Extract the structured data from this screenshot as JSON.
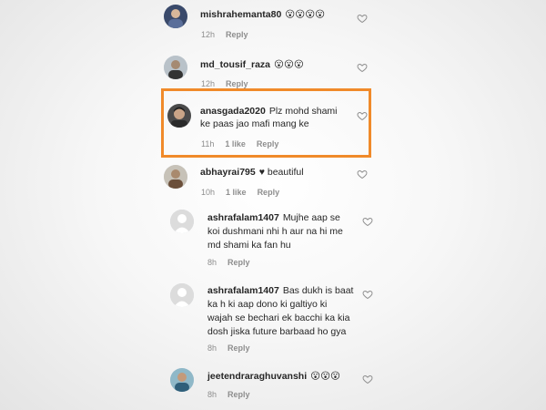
{
  "comments": [
    {
      "username": "mishrahemanta80",
      "text": "😮😮😮😮",
      "line2": "",
      "line3": "",
      "time": "12h",
      "likes": "",
      "reply": "Reply"
    },
    {
      "username": "md_tousif_raza",
      "text": "😮😮😮",
      "line2": "",
      "line3": "",
      "time": "12h",
      "likes": "",
      "reply": "Reply"
    },
    {
      "username": "anasgada2020",
      "text": "Plz mohd shami",
      "line2": "ke paas jao mafi mang ke",
      "line3": "",
      "time": "11h",
      "likes": "1 like",
      "reply": "Reply"
    },
    {
      "username": "abhayrai795",
      "text": "♥ beautiful",
      "line2": "",
      "line3": "",
      "time": "10h",
      "likes": "1 like",
      "reply": "Reply"
    },
    {
      "username": "ashrafalam1407",
      "text": "Mujhe aap se",
      "line2": "koi dushmani nhi h aur na hi me",
      "line3": "md shami ka fan hu",
      "time": "8h",
      "likes": "",
      "reply": "Reply"
    },
    {
      "username": "ashrafalam1407",
      "text": "Bas dukh is baat",
      "line2": "ka h ki aap dono ki galtiyo ki",
      "line3": "wajah se bechari ek bacchi ka kia",
      "line4": "dosh jiska future barbaad ho gya",
      "time": "8h",
      "likes": "",
      "reply": "Reply"
    },
    {
      "username": "jeetendraraghuvanshi",
      "text": "😮😮😮",
      "line2": "",
      "line3": "",
      "time": "8h",
      "likes": "",
      "reply": "Reply"
    }
  ],
  "colors": {
    "highlight": "#f08a2a",
    "meta": "#8e8e8e",
    "text": "#262626"
  },
  "icons": {
    "like": "heart-outline-icon",
    "avatar": "avatar-icon"
  }
}
